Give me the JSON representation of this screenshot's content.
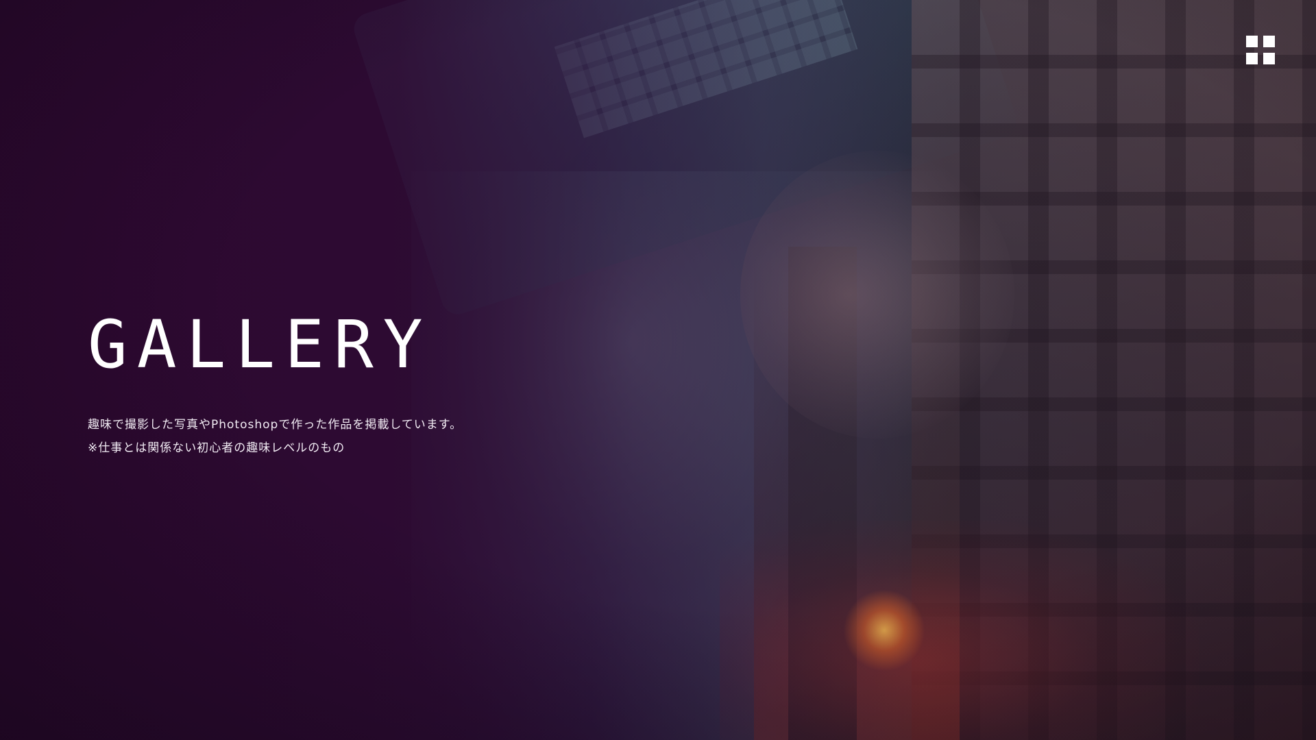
{
  "header": {
    "menu_icon": "grid-menu-icon"
  },
  "hero": {
    "title": "GALLERY",
    "description_line1": "趣味で撮影した写真やPhotoshopで作った作品を掲載しています。",
    "description_line2": "※仕事とは関係ない初心者の趣味レベルのもの"
  },
  "colors": {
    "overlay": "#2d0830",
    "text": "#ffffff",
    "accent_glow": "#f06e28"
  }
}
